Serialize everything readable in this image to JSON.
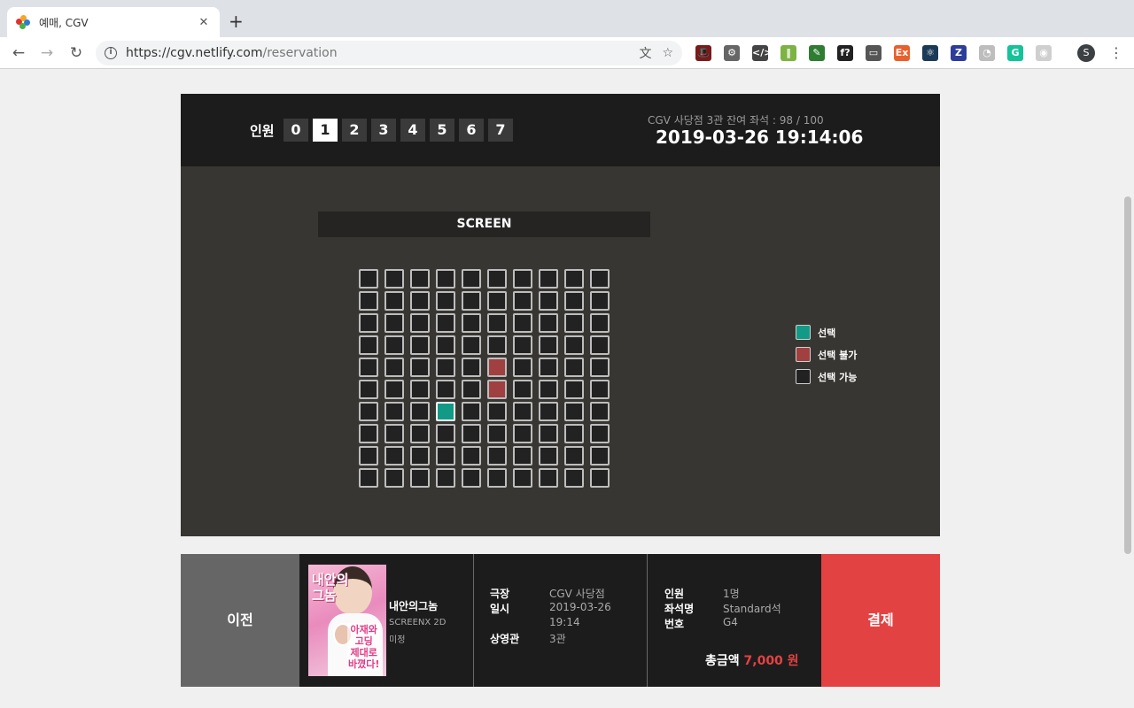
{
  "browser": {
    "tab_title": "예매, CGV",
    "tab_close": "✕",
    "new_tab": "+",
    "url_host": "https://cgv.netlify.com",
    "url_path": "/reservation",
    "profile_initial": "S",
    "extensions": [
      {
        "name": "spy-ext-icon",
        "glyph": "🎩",
        "color": "#7a1a1a"
      },
      {
        "name": "gear-ext-icon",
        "glyph": "⚙",
        "color": "#666666"
      },
      {
        "name": "code-ext-icon",
        "glyph": "</>",
        "color": "#444444"
      },
      {
        "name": "ladder-ext-icon",
        "glyph": "‖",
        "color": "#7cb342"
      },
      {
        "name": "eyedropper-ext-icon",
        "glyph": "✎",
        "color": "#2e7d32"
      },
      {
        "name": "font-ext-icon",
        "glyph": "f?",
        "color": "#222222"
      },
      {
        "name": "cast-ext-icon",
        "glyph": "▭",
        "color": "#555555"
      },
      {
        "name": "ex-ext-icon",
        "glyph": "Ex",
        "color": "#e8612c"
      },
      {
        "name": "react-ext-icon",
        "glyph": "⚛",
        "color": "#1b3a57"
      },
      {
        "name": "z-ext-icon",
        "glyph": "Z",
        "color": "#2c3e9a"
      },
      {
        "name": "owl-ext-icon",
        "glyph": "◔",
        "color": "#bdbdbd"
      },
      {
        "name": "grammarly-ext-icon",
        "glyph": "G",
        "color": "#15c39a"
      },
      {
        "name": "discord-ext-icon",
        "glyph": "◉",
        "color": "#cfcfcf"
      }
    ]
  },
  "header": {
    "people_label": "인원",
    "people_options": [
      "0",
      "1",
      "2",
      "3",
      "4",
      "5",
      "6",
      "7"
    ],
    "people_selected": "1",
    "theater_info": "CGV 사당점  3관  잔여 좌석 : 98 / 100",
    "datetime": "2019-03-26 19:14:06"
  },
  "seats": {
    "screen_label": "SCREEN",
    "rows": 10,
    "cols": 10,
    "sold": [
      [
        4,
        5
      ],
      [
        5,
        5
      ]
    ],
    "selected": [
      [
        6,
        3
      ]
    ],
    "colors": {
      "selected": "#139a86",
      "sold": "#a04040",
      "available": "#232222"
    }
  },
  "legend": [
    {
      "label": "선택",
      "color": "#139a86"
    },
    {
      "label": "선택 불가",
      "color": "#a04040"
    },
    {
      "label": "선택 가능",
      "color": "#232222"
    }
  ],
  "summary": {
    "prev_label": "이전",
    "pay_label": "결제",
    "poster": {
      "title_line1": "내안의",
      "title_line2": "그놈",
      "tagline_line1": "아재와",
      "tagline_line2": "고딩",
      "tagline_line3": "제대로",
      "tagline_line4": "바꼈다!"
    },
    "movie_name": "내안의그놈",
    "movie_format": "SCREENX 2D",
    "movie_rating": "미정",
    "theater_label": "극장",
    "theater_value": "CGV 사당점",
    "datetime_label": "일시",
    "date_value": "2019-03-26",
    "time_value": "19:14",
    "hall_label": "상영관",
    "hall_value": "3관",
    "people_label": "인원",
    "people_value": "1명",
    "seat_type_label": "좌석명",
    "seat_type_value": "Standard석",
    "seat_no_label": "번호",
    "seat_no_value": "G4",
    "total_label": "총금액",
    "total_value": "7,000 원"
  }
}
